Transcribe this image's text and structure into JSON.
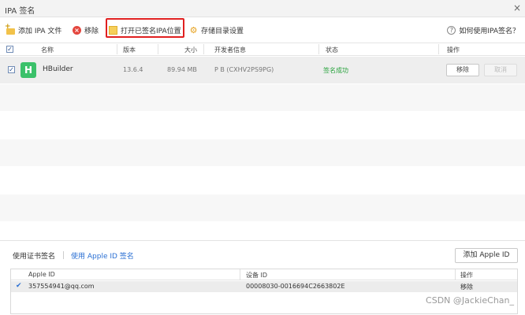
{
  "window": {
    "title": "IPA 签名",
    "close": "×"
  },
  "toolbar": {
    "add_ipa": "添加 IPA 文件",
    "remove": "移除",
    "open_signed_location": "打开已签名IPA位置",
    "storage_settings": "存储目录设置",
    "help": "如何使用IPA签名？"
  },
  "table": {
    "columns": [
      "名称",
      "版本",
      "大小",
      "开发者信息",
      "状态",
      "操作"
    ],
    "rows": [
      {
        "icon_letter": "H",
        "name": "HBuilder",
        "version": "13.6.4",
        "size": "89.94 MB",
        "developer": "P B (CXHV2PS9PG)",
        "status": "签名成功",
        "remove_label": "移除",
        "cancel_label": "取消"
      }
    ]
  },
  "bottom": {
    "tab_cert": "使用证书签名",
    "tab_apple_id": "使用 Apple ID 签名",
    "add_apple_id": "添加 Apple ID",
    "columns": [
      "Apple ID",
      "设备 ID",
      "操作"
    ],
    "rows": [
      {
        "apple_id": "357554941@qq.com",
        "device_id": "00008030-0016694C2663802E",
        "action": "移除"
      }
    ]
  },
  "watermark": "CSDN @JackieChan_",
  "colors": {
    "accent": "#2a6fd3",
    "success": "#27a23c",
    "highlight_border": "#e02020"
  }
}
